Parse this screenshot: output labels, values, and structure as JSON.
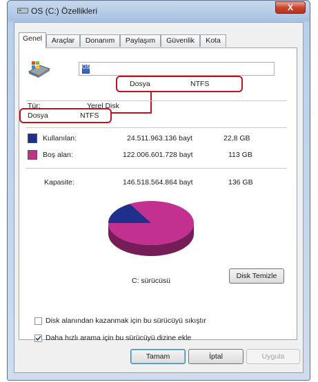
{
  "window": {
    "title": "OS (C:) Özellikleri",
    "close_label": "X"
  },
  "tabs": [
    "Genel",
    "Araçlar",
    "Donanım",
    "Paylaşım",
    "Güvenlik",
    "Kota"
  ],
  "name_field": {
    "value": "OS"
  },
  "callout": {
    "label": "Dosya",
    "value": "NTFS"
  },
  "type_row": {
    "label": "Tür:",
    "value": "Yerel Disk"
  },
  "fs_row": {
    "label": "Dosya",
    "value": "NTFS"
  },
  "used": {
    "label": "Kullanılan:",
    "bytes": "24.511.963.136 bayt",
    "size": "22,8 GB",
    "color": "#1f2f8c"
  },
  "free": {
    "label": "Boş alan:",
    "bytes": "122.006.601.728 bayt",
    "size": "113 GB",
    "color": "#c2318f"
  },
  "capacity": {
    "label": "Kapasite:",
    "bytes": "146.518.564.864 bayt",
    "size": "136 GB"
  },
  "pie": {
    "used_fraction": 0.167
  },
  "drive_label": "C: sürücüsü",
  "cleanup_button": "Disk Temizle",
  "compress_option": {
    "label": "Disk alanından kazanmak için bu sürücüyü sıkıştır",
    "checked": false
  },
  "index_option": {
    "label": "Daha hızlı arama için bu sürücüyü dizine ekle",
    "checked": true
  },
  "buttons": {
    "ok": "Tamam",
    "cancel": "İptal",
    "apply": "Uygula"
  }
}
